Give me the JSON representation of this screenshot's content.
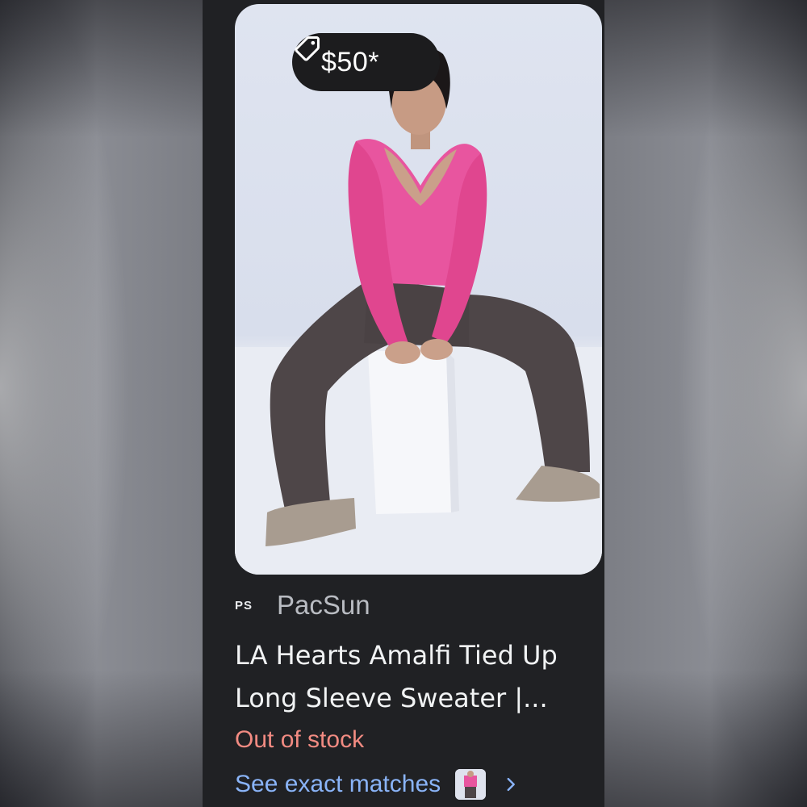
{
  "price": {
    "label": "$50*"
  },
  "source": {
    "logo_text": "PS",
    "name": "PacSun"
  },
  "product": {
    "title_line1": "LA Hearts Amalfi Tied Up",
    "title_line2": "Long Sleeve Sweater |..."
  },
  "availability": {
    "label": "Out of stock"
  },
  "matches": {
    "label": "See exact matches"
  },
  "icons": {
    "price_tag": "price-tag-icon",
    "chevron": "chevron-right-icon"
  },
  "colors": {
    "card_background": "#202124",
    "out_of_stock": "#f28b82",
    "link": "#8ab4f8",
    "sweater": "#e8559f",
    "pants": "#4e4648"
  }
}
